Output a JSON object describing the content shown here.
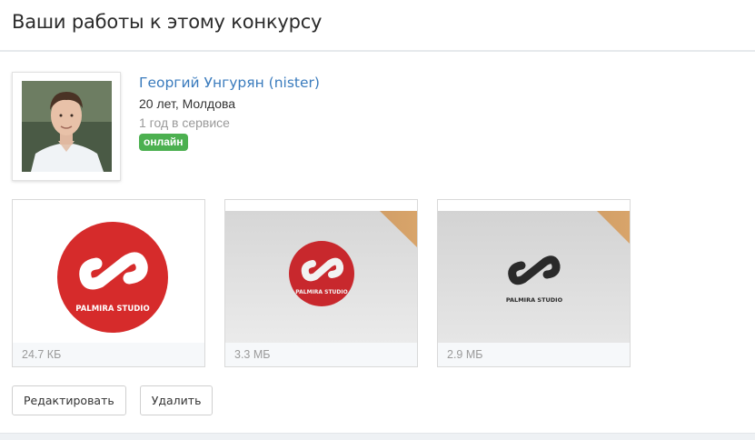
{
  "header": {
    "title": "Ваши работы к этому конкурсу"
  },
  "user": {
    "name": "Георгий Унгурян (nister)",
    "meta": "20 лет, Молдова",
    "tenure": "1 год в сервисе",
    "status": "онлайн"
  },
  "works": [
    {
      "size": "24.7 КБ",
      "brand": "PALMIRA STUDIO"
    },
    {
      "size": "3.3 МБ",
      "brand": "PALMIRA STUDIO"
    },
    {
      "size": "2.9 МБ",
      "brand": "PALMIRA STUDIO"
    }
  ],
  "actions": {
    "edit_label": "Редактировать",
    "delete_label": "Удалить"
  },
  "colors": {
    "link": "#3a7bbd",
    "online": "#4cb050",
    "logo_red": "#d62b2b"
  }
}
